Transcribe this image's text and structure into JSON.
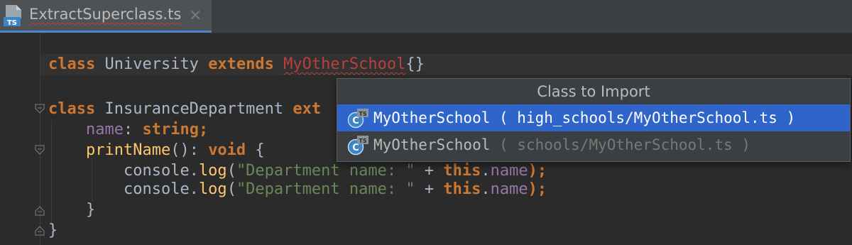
{
  "tab": {
    "title": "ExtractSuperclass.ts",
    "icon_label": "TS",
    "close_glyph": "×"
  },
  "editor": {
    "line1": {
      "kw_class": "class",
      "name": " University ",
      "kw_extends": "extends",
      "space": " ",
      "superclass": "MyOtherSchool",
      "braces": "{}"
    },
    "line2": {
      "kw_class": "class",
      "name": " InsuranceDepartment ",
      "kw_extends_partial": "ext"
    },
    "line3": {
      "indent": "    ",
      "prop": "name",
      "colon": ": ",
      "type": "string",
      "semi": ";"
    },
    "line4": {
      "indent": "    ",
      "fn": "printName",
      "sig": "(): ",
      "kw_void": "void",
      "brace": " {"
    },
    "line5": {
      "indent": "        ",
      "obj": "console.",
      "fn": "log",
      "open": "(",
      "str": "\"Department name: \"",
      "plus": " + ",
      "kw_this": "this",
      "dot": ".",
      "prop": "name",
      "close": ");"
    },
    "line6": {
      "indent": "        ",
      "obj": "console.",
      "fn": "log",
      "open": "(",
      "str": "\"Department name: \"",
      "plus": " + ",
      "kw_this": "this",
      "dot": ".",
      "prop": "name",
      "close": ");"
    },
    "line7": {
      "text": "    }"
    },
    "line8": {
      "text": "}"
    }
  },
  "popup": {
    "title": "Class to Import",
    "items": [
      {
        "name": "MyOtherSchool",
        "path": " ( high_schools/MyOtherSchool.ts )",
        "icon_label": "TS",
        "selected": true
      },
      {
        "name": "MyOtherSchool",
        "path": " ( schools/MyOtherSchool.ts )",
        "icon_label": "TS",
        "selected": false
      }
    ]
  },
  "colors": {
    "editor_bg": "#2b2b2b",
    "keyword": "#cc7832",
    "error": "#bc3f3c",
    "property": "#9876aa",
    "function": "#ffc66d",
    "string": "#6a8759",
    "selection": "#2f65ca"
  }
}
